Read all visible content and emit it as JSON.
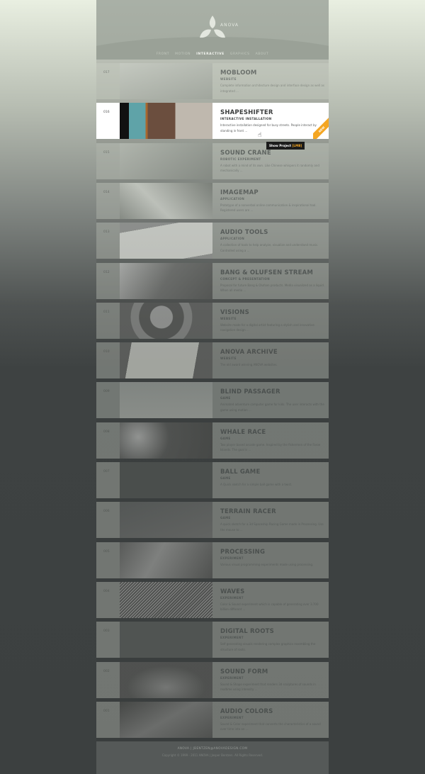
{
  "header": {
    "brand": "ANOVA",
    "logo": "trefoil-leaf-logo"
  },
  "nav": [
    {
      "label": "FRONT"
    },
    {
      "label": "MOTION"
    },
    {
      "label": "INTERACTIVE",
      "active": true
    },
    {
      "label": "GRAPHICS"
    },
    {
      "label": "ABOUT"
    }
  ],
  "projects": [
    {
      "num": "017",
      "title": "MOBLOOM",
      "cat": "WEBSITE",
      "desc": "Complete information architecture design and interface design as well as integrated ..."
    },
    {
      "num": "016",
      "title": "SHAPESHIFTER",
      "cat": "INTERACTIVE INSTALLATION",
      "desc": "Interactive installation designed for busy streets. People interact by standing in front ...",
      "badge": "NEW"
    },
    {
      "num": "015",
      "title": "SOUND CRANE",
      "cat": "ROBOTIC EXPERIMENT",
      "desc": "A robot with a mind of its own. Like Chinese whispers it randomly and mechanically ..."
    },
    {
      "num": "014",
      "title": "IMAGEMAP",
      "cat": "APPLICATION",
      "desc": "Prototype of a nonverbal online communication & inspirational tool. Registered users are ..."
    },
    {
      "num": "013",
      "title": "AUDIO TOOLS",
      "cat": "APPLICATION",
      "desc": "A collection of tools to help analyze, visualize and understand music. Controlled using a ..."
    },
    {
      "num": "012",
      "title": "BANG & OLUFSEN STREAM",
      "cat": "CONCEPT & PRESENTATION",
      "desc": "Proposal for future Bang & Olufsen products. Media visualized as a liquid. When all media ..."
    },
    {
      "num": "011",
      "title": "VISIONS",
      "cat": "WEBSITE",
      "desc": "Website made for a digital artist featuring a stylish and innovative navigation design ..."
    },
    {
      "num": "010",
      "title": "ANOVA ARCHIVE",
      "cat": "WEBSITE",
      "desc": "The old award winning ANOVA websites."
    },
    {
      "num": "009",
      "title": "BLIND PASSAGER",
      "cat": "GAME",
      "desc": "Animated adventure computer game for kids. The user interacts with the game using motion ..."
    },
    {
      "num": "008",
      "title": "WHALE RACE",
      "cat": "GAME",
      "desc": "Two player based arcade game. Inspired by the fishermen of the Faroe Islands. The goal is ..."
    },
    {
      "num": "007",
      "title": "BALL GAME",
      "cat": "GAME",
      "desc": "A Quick sketch for a simple ball game with a twist."
    },
    {
      "num": "006",
      "title": "TERRAIN RACER",
      "cat": "GAME",
      "desc": "A quick sketch for a 3d Spaceship Racing Game made in Processing. Use the mouse to ..."
    },
    {
      "num": "005",
      "title": "PROCESSING",
      "cat": "EXPERIMENT",
      "desc": "Various visual programming experiments made using processing."
    },
    {
      "num": "004",
      "title": "WAVES",
      "cat": "EXPERIMENT",
      "desc": "Color & Sound experiment which is capable of generating over 3.700 billion different ..."
    },
    {
      "num": "003",
      "title": "DIGITAL ROOTS",
      "cat": "EXPERIMENT",
      "desc": "Self generating visuals rendering complex graphics resembling the structure of roots."
    },
    {
      "num": "002",
      "title": "SOUND FORM",
      "cat": "EXPERIMENT",
      "desc": "Sound & Shape experiment that renders 3d sculptures of sounds in realtime using intensity ..."
    },
    {
      "num": "001",
      "title": "AUDIO COLORS",
      "cat": "EXPERIMENT",
      "desc": "Sound & Color experiment that converts the characteristics of a sound over time into an ..."
    }
  ],
  "tooltip": {
    "text": "Show Project",
    "key": "[LMB]"
  },
  "footer": {
    "contact": "ANOVA | JBENTZEN@ANOVADESIGN.COM",
    "copyright": "Copyright © 1999 - 2011 ANOVA | Jesper Bentzen. All Rights Reserved."
  },
  "colors": {
    "accent": "#f4a622",
    "highlight_bg": "#ffffff"
  }
}
